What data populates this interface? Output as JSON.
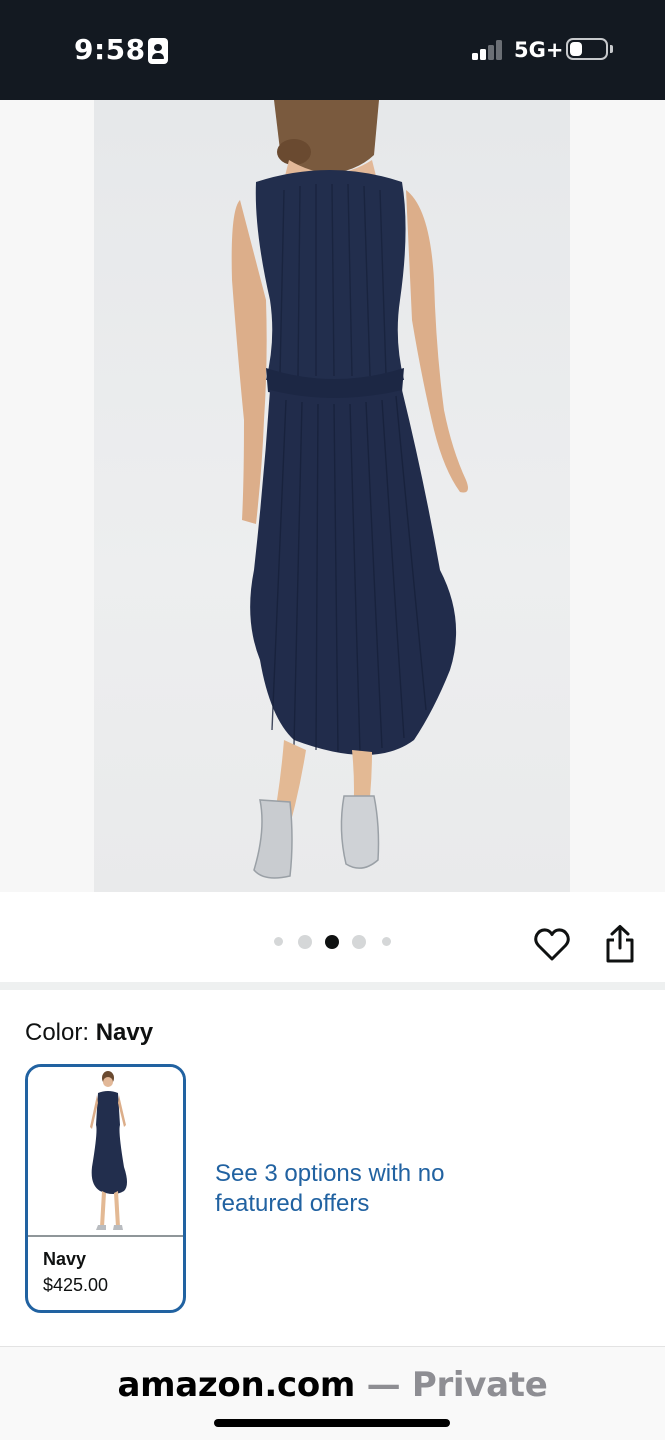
{
  "status_bar": {
    "time": "9:58",
    "network": "5G+",
    "icons": [
      "id-card-icon",
      "signal-icon",
      "battery-icon"
    ]
  },
  "product_image": {
    "carousel_total": 5,
    "carousel_active_index": 2
  },
  "actions": {
    "wishlist_icon": "heart-icon",
    "share_icon": "share-icon"
  },
  "color_selector": {
    "label": "Color: ",
    "selected": "Navy",
    "swatches": [
      {
        "name": "Navy",
        "price": "$425.00"
      }
    ],
    "options_link": "See 3 options with no featured offers"
  },
  "browser_bar": {
    "domain": "amazon.com",
    "mode": " — Private"
  },
  "colors": {
    "header_bg": "#131921",
    "link": "#2162a1",
    "dress": "#1f2b4a",
    "swatch_border": "#2162a1"
  }
}
